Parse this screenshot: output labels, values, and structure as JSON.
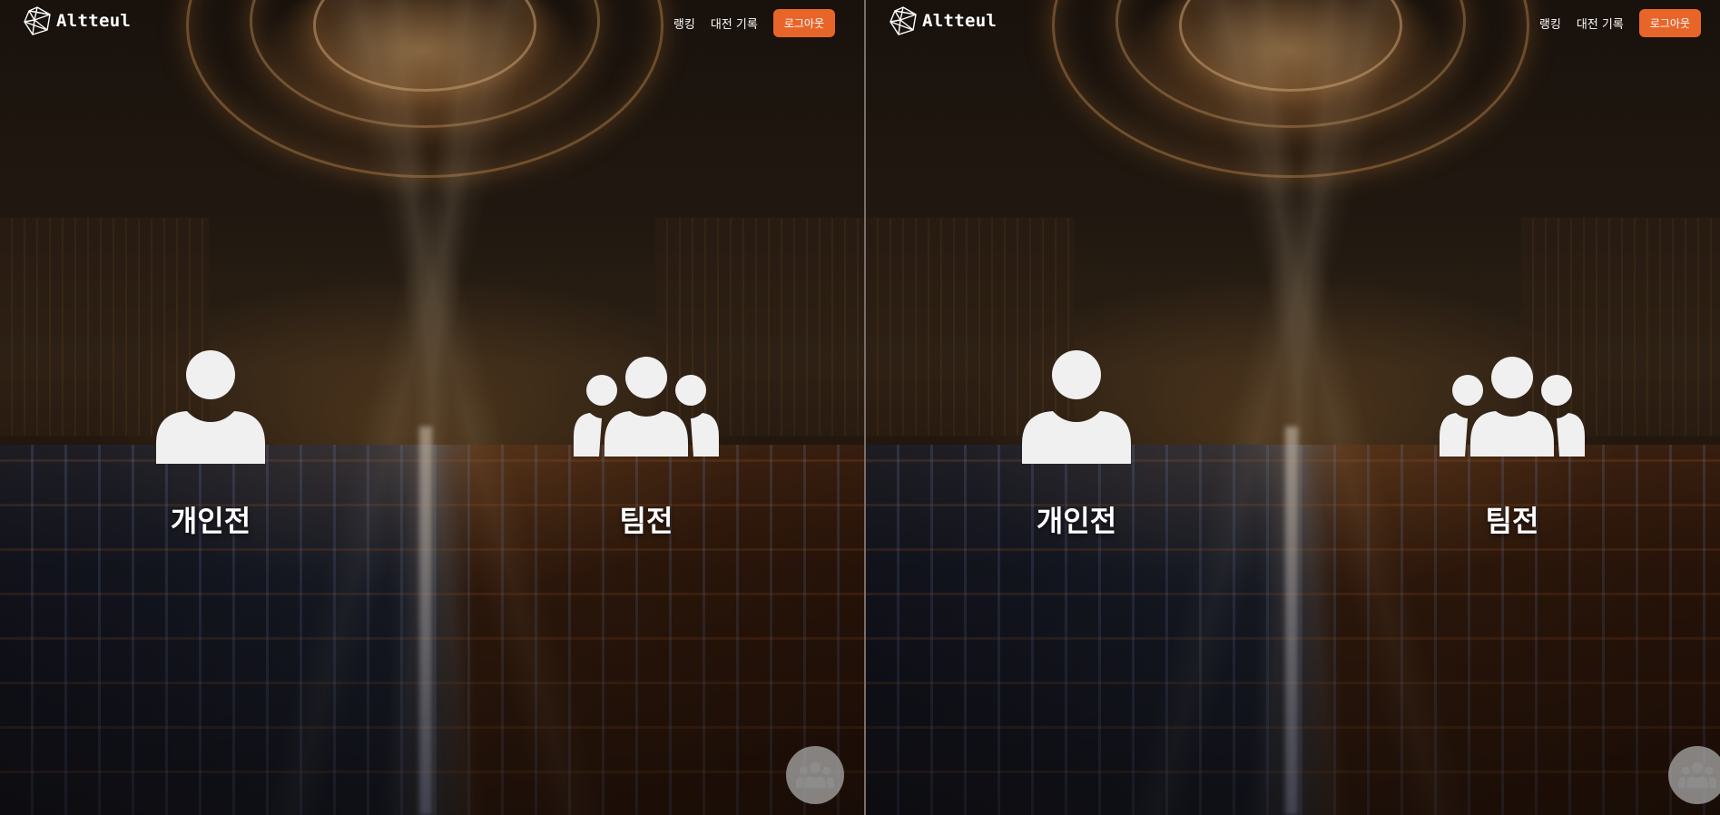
{
  "brand": {
    "name": "Altteul",
    "logo_icon": "polyhedron-logo-icon"
  },
  "nav": {
    "ranking_label": "랭킹",
    "history_label": "대전 기록",
    "logout_label": "로그아웃"
  },
  "modes": {
    "individual": {
      "label": "개인전",
      "icon": "person-icon"
    },
    "team": {
      "label": "팀전",
      "icon": "group-icon"
    }
  },
  "fab": {
    "icon": "group-icon"
  },
  "colors": {
    "accent": "#e8652a",
    "text": "#ffffff",
    "icon": "#f0f0f0"
  }
}
